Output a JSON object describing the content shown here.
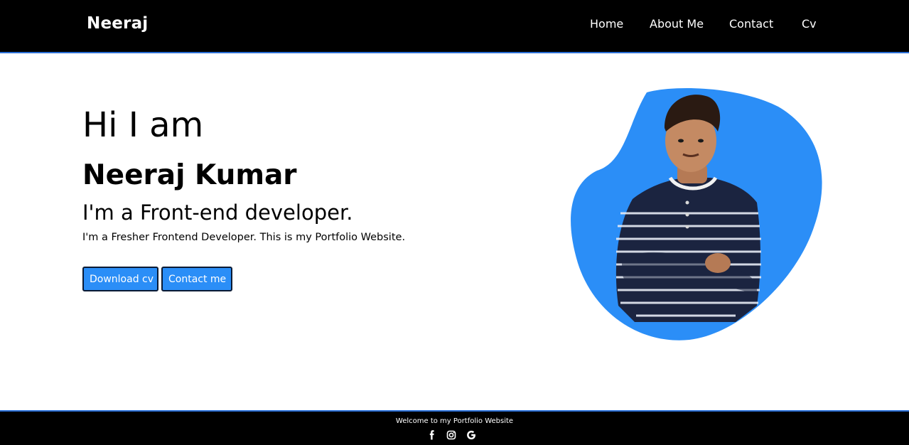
{
  "header": {
    "brand": "Neeraj",
    "nav": {
      "home": "Home",
      "about": "About Me",
      "contact": "Contact",
      "cv": "Cv"
    }
  },
  "hero": {
    "greeting": "Hi I am",
    "name": "Neeraj Kumar",
    "role": "I'm a Front-end developer.",
    "description": "I'm a Fresher Frontend Developer. This is my Portfolio Website.",
    "buttons": {
      "download": "Download cv",
      "contact": "Contact me"
    }
  },
  "footer": {
    "text": "Welcome to my Portfolio Website",
    "social_icons": [
      "facebook-icon",
      "instagram-icon",
      "google-icon"
    ]
  },
  "colors": {
    "header_bg": "#000000",
    "accent_border": "#2a6fd6",
    "button_bg": "#2b8ef7",
    "blob": "#2b8ef7",
    "shirt": "#1b2440"
  }
}
